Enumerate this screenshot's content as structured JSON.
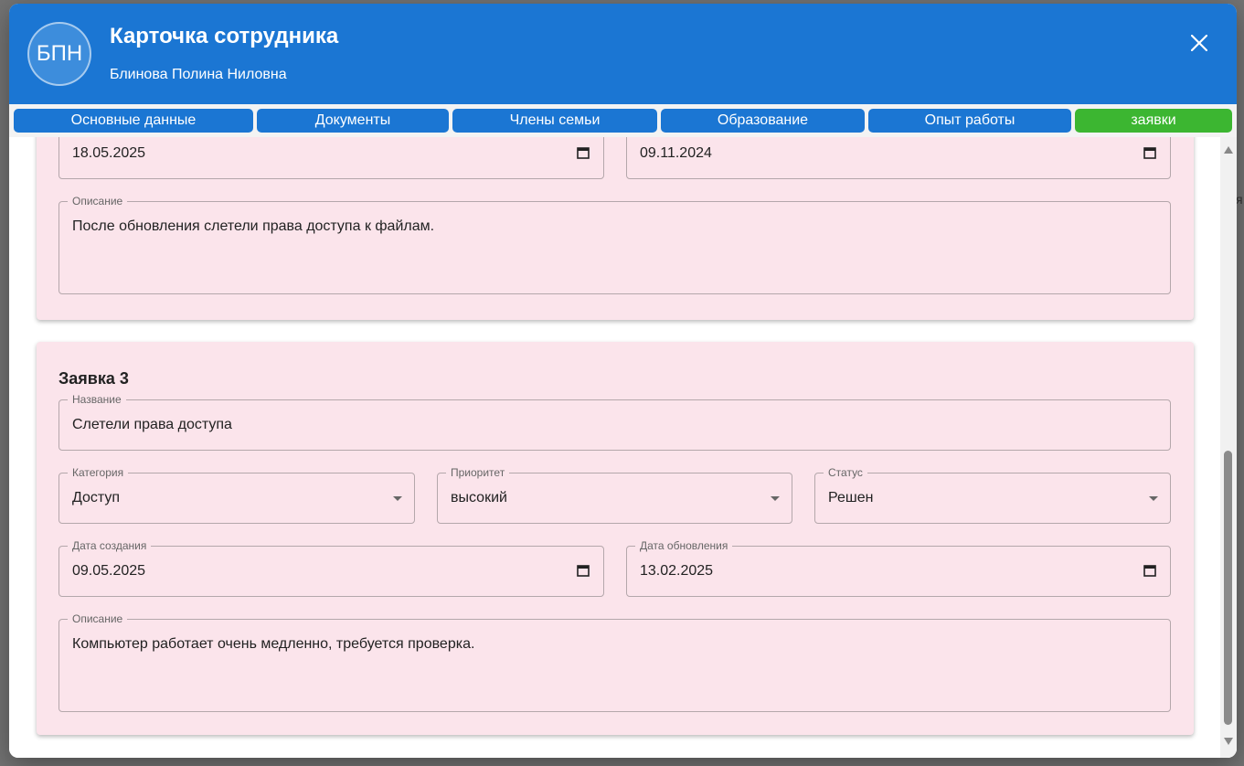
{
  "window": {
    "avatar_initials": "БПН",
    "title": "Карточка сотрудника",
    "subtitle": "Блинова Полина Ниловна"
  },
  "tabs": [
    {
      "label": "Основные данные"
    },
    {
      "label": "Документы"
    },
    {
      "label": "Члены семьи"
    },
    {
      "label": "Образование"
    },
    {
      "label": "Опыт работы"
    },
    {
      "label": "заявки",
      "active": true
    }
  ],
  "request_prev": {
    "created_date": "18.05.2025",
    "updated_date": "09.11.2024",
    "description_label": "Описание",
    "description": "После обновления слетели права доступа к файлам."
  },
  "request3": {
    "title": "Заявка 3",
    "name_label": "Название",
    "name": "Слетели права доступа",
    "category_label": "Категория",
    "category": "Доступ",
    "priority_label": "Приоритет",
    "priority": "высокий",
    "status_label": "Статус",
    "status": "Решен",
    "created_label": "Дата создания",
    "created_date": "09.05.2025",
    "updated_label": "Дата обновления",
    "updated_date": "13.02.2025",
    "description_label": "Описание",
    "description": "Компьютер работает очень медленно, требуется проверка."
  },
  "backdrop_text": "я",
  "colors": {
    "header": "#1b76d3",
    "tab": "#1b76d3",
    "tab_active": "#3cb631",
    "card": "#fbe4eb"
  }
}
